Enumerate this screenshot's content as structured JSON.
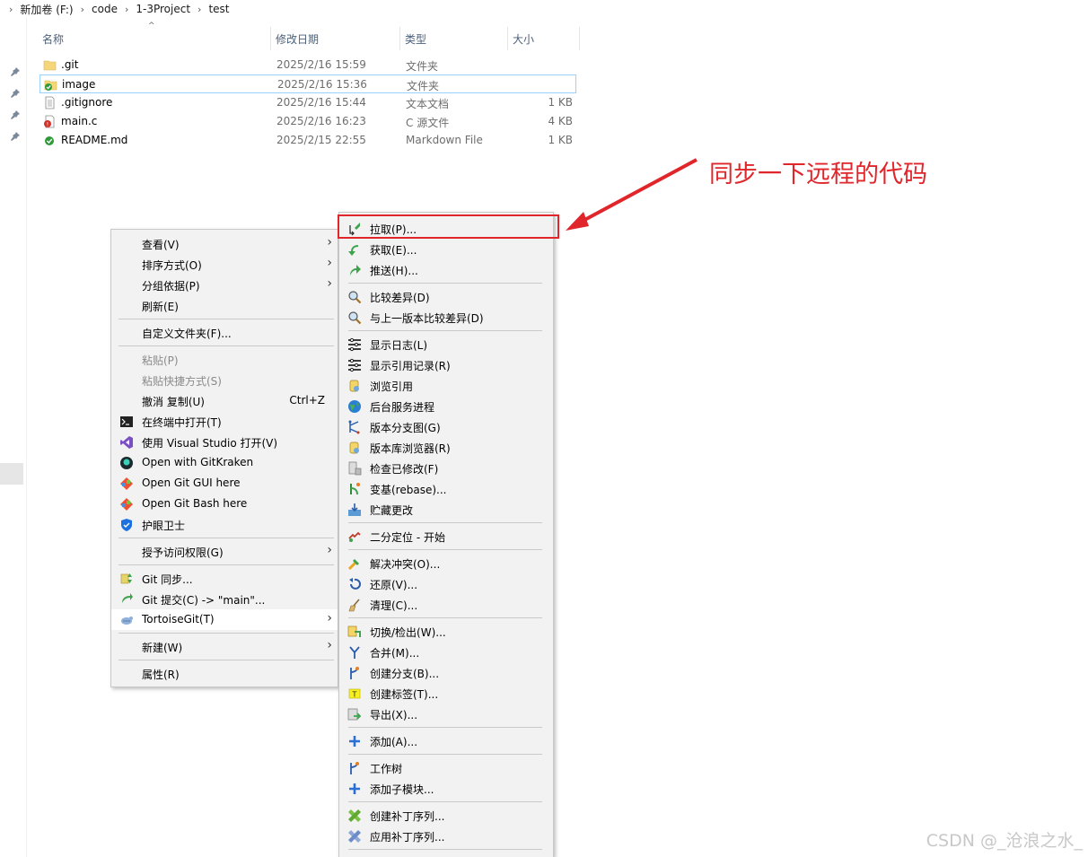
{
  "breadcrumb": {
    "items": [
      "新加卷 (F:)",
      "code",
      "1-3Project",
      "test"
    ]
  },
  "columns": {
    "name": "名称",
    "date": "修改日期",
    "type": "类型",
    "size": "大小"
  },
  "files": [
    {
      "name": ".git",
      "date": "2025/2/16 15:59",
      "type": "文件夹",
      "size": "",
      "icon": "folder-icon"
    },
    {
      "name": "image",
      "date": "2025/2/16 15:36",
      "type": "文件夹",
      "size": "",
      "icon": "git-folder-ok-icon"
    },
    {
      "name": ".gitignore",
      "date": "2025/2/16 15:44",
      "type": "文本文档",
      "size": "1 KB",
      "icon": "text-file-icon"
    },
    {
      "name": "main.c",
      "date": "2025/2/16 16:23",
      "type": "C 源文件",
      "size": "4 KB",
      "icon": "c-file-modified-icon"
    },
    {
      "name": "README.md",
      "date": "2025/2/15 22:55",
      "type": "Markdown File",
      "size": "1 KB",
      "icon": "git-file-ok-icon"
    }
  ],
  "context_menu": {
    "items": [
      {
        "label": "查看(V)",
        "arrow": "›"
      },
      {
        "label": "排序方式(O)",
        "arrow": "›"
      },
      {
        "label": "分组依据(P)",
        "arrow": "›"
      },
      {
        "label": "刷新(E)"
      },
      {
        "label": "自定义文件夹(F)..."
      },
      {
        "label": "粘贴(P)"
      },
      {
        "label": "粘贴快捷方式(S)"
      },
      {
        "label": "撤消 复制(U)",
        "shortcut": "Ctrl+Z"
      },
      {
        "label": "在终端中打开(T)"
      },
      {
        "label": "使用 Visual Studio 打开(V)"
      },
      {
        "label": "Open with GitKraken"
      },
      {
        "label": "Open Git GUI here"
      },
      {
        "label": "Open Git Bash here"
      },
      {
        "label": "护眼卫士"
      },
      {
        "label": "授予访问权限(G)",
        "arrow": "›"
      },
      {
        "label": "Git 同步..."
      },
      {
        "label": "Git 提交(C) -> \"main\"..."
      },
      {
        "label": "TortoiseGit(T)",
        "arrow": "›"
      },
      {
        "label": "新建(W)",
        "arrow": "›"
      },
      {
        "label": "属性(R)"
      }
    ]
  },
  "tortoise_menu": {
    "items": [
      "拉取(P)...",
      "获取(E)...",
      "推送(H)...",
      "比较差异(D)",
      "与上一版本比较差异(D)",
      "显示日志(L)",
      "显示引用记录(R)",
      "浏览引用",
      "后台服务进程",
      "版本分支图(G)",
      "版本库浏览器(R)",
      "检查已修改(F)",
      "变基(rebase)...",
      "贮藏更改",
      "二分定位 - 开始",
      "解决冲突(O)...",
      "还原(V)...",
      "清理(C)...",
      "切换/检出(W)...",
      "合并(M)...",
      "创建分支(B)...",
      "创建标签(T)...",
      "导出(X)...",
      "添加(A)...",
      "工作树",
      "添加子模块...",
      "创建补丁序列...",
      "应用补丁序列..."
    ]
  },
  "annotation": "同步一下远程的代码",
  "watermark": "CSDN @_沧浪之水_",
  "colors": {
    "accent": "#e0262b",
    "selection": "#99d1ff"
  }
}
